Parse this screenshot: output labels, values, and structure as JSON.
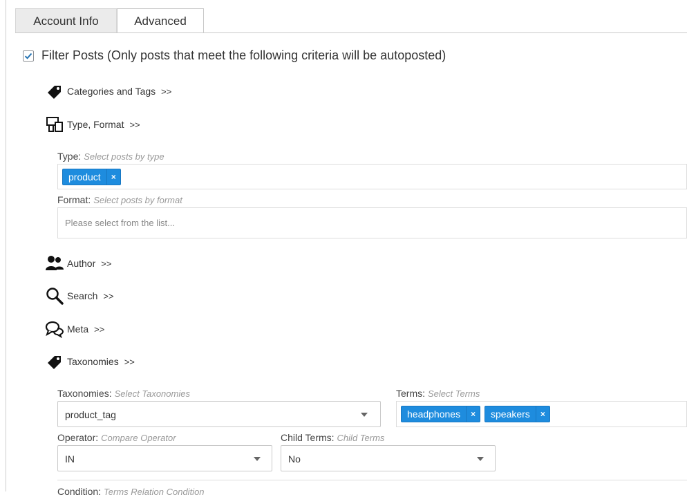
{
  "tabs": [
    {
      "label": "Account Info"
    },
    {
      "label": "Advanced"
    }
  ],
  "filter": {
    "checked": true,
    "label": "Filter Posts (Only posts that meet the following criteria will be autoposted)"
  },
  "sections": {
    "categories": {
      "label": "Categories and Tags",
      "chevron": ">>",
      "icon": "tag-icon"
    },
    "type_format": {
      "label": "Type, Format",
      "chevron": ">>",
      "icon": "devices-icon"
    },
    "author": {
      "label": "Author",
      "chevron": ">>",
      "icon": "users-icon"
    },
    "search": {
      "label": "Search",
      "chevron": ">>",
      "icon": "search-icon"
    },
    "meta": {
      "label": "Meta",
      "chevron": ">>",
      "icon": "chat-icon"
    },
    "taxonomies": {
      "label": "Taxonomies",
      "chevron": ">>",
      "icon": "tag-icon"
    }
  },
  "type_field": {
    "label": "Type:",
    "hint": "Select posts by type",
    "tags": [
      "product"
    ]
  },
  "format_field": {
    "label": "Format:",
    "hint": "Select posts by format",
    "placeholder": "Please select from the list..."
  },
  "taxonomies_field": {
    "label": "Taxonomies:",
    "hint": "Select Taxonomies",
    "value": "product_tag"
  },
  "terms_field": {
    "label": "Terms:",
    "hint": "Select Terms",
    "tags": [
      "headphones",
      "speakers"
    ]
  },
  "operator_field": {
    "label": "Operator:",
    "hint": "Compare Operator",
    "value": "IN"
  },
  "child_terms_field": {
    "label": "Child Terms:",
    "hint": "Child Terms",
    "value": "No"
  },
  "remove_symbol": "×",
  "cut_field": {
    "label": "Condition:",
    "hint": "Terms Relation Condition"
  },
  "colors": {
    "tag_bg": "#1e8cde",
    "checkbox_check": "#2271b1"
  }
}
